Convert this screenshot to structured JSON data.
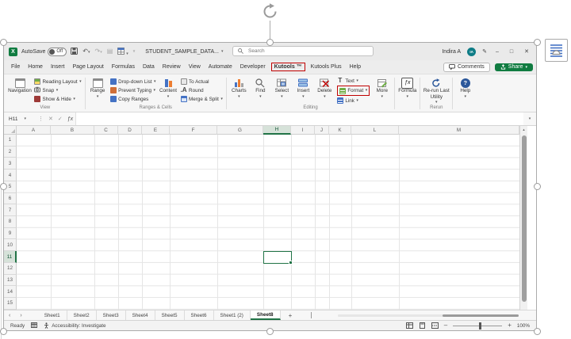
{
  "colors": {
    "excel_green": "#107C41",
    "accent_green": "#217346",
    "annotation_red": "#C00000",
    "avatar_teal": "#0E7C86",
    "office_blue": "#2B579A"
  },
  "titlebar": {
    "autosave_label": "AutoSave",
    "autosave_state": "Off",
    "doc_title": "STUDENT_SAMPLE_DATA...",
    "search_placeholder": "Search",
    "user_name": "Indira A",
    "user_initials": "IA",
    "window_buttons": {
      "minimize": "–",
      "maximize": "□",
      "close": "✕"
    }
  },
  "ribbon_tabs": [
    {
      "label": "File"
    },
    {
      "label": "Home"
    },
    {
      "label": "Insert"
    },
    {
      "label": "Page Layout"
    },
    {
      "label": "Formulas"
    },
    {
      "label": "Data"
    },
    {
      "label": "Review"
    },
    {
      "label": "View"
    },
    {
      "label": "Automate"
    },
    {
      "label": "Developer"
    },
    {
      "label": "Kutools ™",
      "highlighted": true
    },
    {
      "label": "Kutools Plus"
    },
    {
      "label": "Help"
    }
  ],
  "tab_actions": {
    "comments": "Comments",
    "share": "Share"
  },
  "ribbon": {
    "view_group": {
      "big": "Navigation",
      "items": [
        "Reading Layout",
        "Snap",
        "Show & Hide"
      ],
      "label": "View"
    },
    "ranges_group": {
      "big1": "Range",
      "col1": [
        "Drop-down List",
        "Prevent Typing",
        "Copy Ranges"
      ],
      "big2": "Content",
      "col2": [
        "To Actual",
        "Round",
        "Merge & Split"
      ],
      "label": "Ranges & Cells"
    },
    "editing_group": {
      "bigs": [
        "Charts",
        "Find",
        "Select",
        "Insert",
        "Delete"
      ],
      "col": [
        "Text",
        "Format",
        "Link"
      ],
      "more": "More",
      "label": "Editing"
    },
    "formula_button": "Formula",
    "rerun_group": {
      "big_line1": "Re-run Last",
      "big_line2": "Utility",
      "label": "Rerun"
    },
    "help_button": "Help"
  },
  "formula_bar": {
    "name_box": "H11",
    "fx": "ƒx"
  },
  "grid": {
    "columns": [
      "A",
      "B",
      "C",
      "D",
      "E",
      "F",
      "G",
      "H",
      "I",
      "J",
      "K",
      "L",
      "M"
    ],
    "selected_column": "H",
    "rows": [
      "1",
      "2",
      "3",
      "4",
      "5",
      "6",
      "7",
      "8",
      "9",
      "10",
      "11",
      "12",
      "13",
      "14",
      "15"
    ],
    "selected_row": "11",
    "active_cell": "H11"
  },
  "sheet_tabs": {
    "tabs": [
      "Sheet1",
      "Sheet2",
      "Sheet3",
      "Sheet4",
      "Sheet5",
      "Sheet6",
      "Sheet1 (2)",
      "Sheet8"
    ],
    "active": "Sheet8",
    "add_label": "+"
  },
  "status_bar": {
    "ready": "Ready",
    "accessibility": "Accessibility: Investigate",
    "zoom": "100%"
  }
}
